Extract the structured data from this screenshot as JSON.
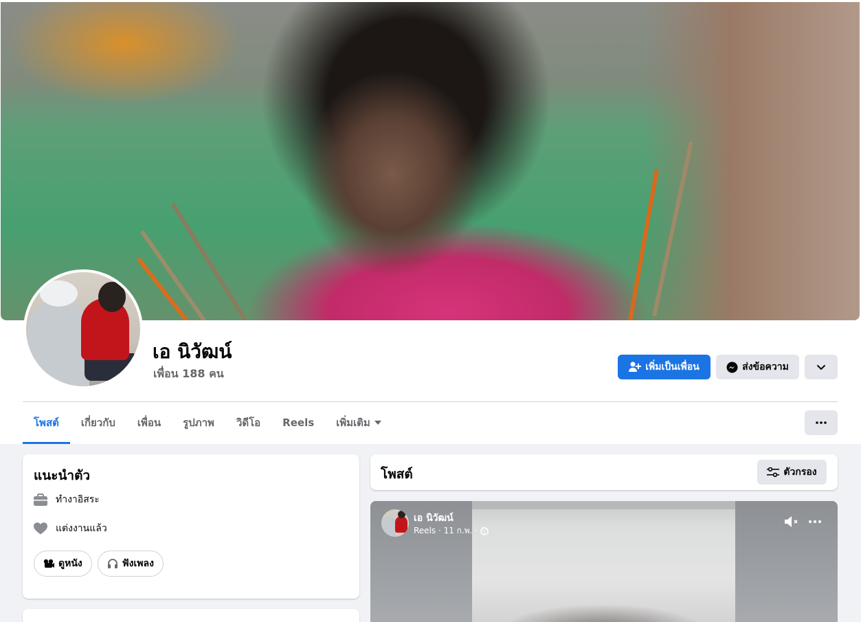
{
  "profile": {
    "name": "เอ นิวัฒน์",
    "friends_count": "เพื่อน 188 คน"
  },
  "actions": {
    "add_friend": "เพิ่มเป็นเพื่อน",
    "message": "ส่งข้อความ"
  },
  "tabs": [
    {
      "label": "โพสต์",
      "active": true
    },
    {
      "label": "เกี่ยวกับ",
      "active": false
    },
    {
      "label": "เพื่อน",
      "active": false
    },
    {
      "label": "รูปภาพ",
      "active": false
    },
    {
      "label": "วิดีโอ",
      "active": false
    },
    {
      "label": "Reels",
      "active": false
    },
    {
      "label": "เพิ่มเติม",
      "active": false
    }
  ],
  "intro": {
    "title": "แนะนำตัว",
    "work": "ทำงาอิสระ",
    "relationship": "แต่งงานแล้ว",
    "hobbies": [
      {
        "label": "ดูหนัง",
        "icon": "film-icon"
      },
      {
        "label": "ฟังเพลง",
        "icon": "headphones-icon"
      }
    ]
  },
  "posts": {
    "title": "โพสต์",
    "filter_label": "ตัวกรอง"
  },
  "reel_post": {
    "author": "เอ นิวัฒน์",
    "meta": "Reels · 11 ก.พ. ·",
    "audience_icon": "globe-icon"
  },
  "colors": {
    "accent": "#1b74e4",
    "background": "#f0f2f5",
    "secondary_button": "#e4e6eb"
  }
}
